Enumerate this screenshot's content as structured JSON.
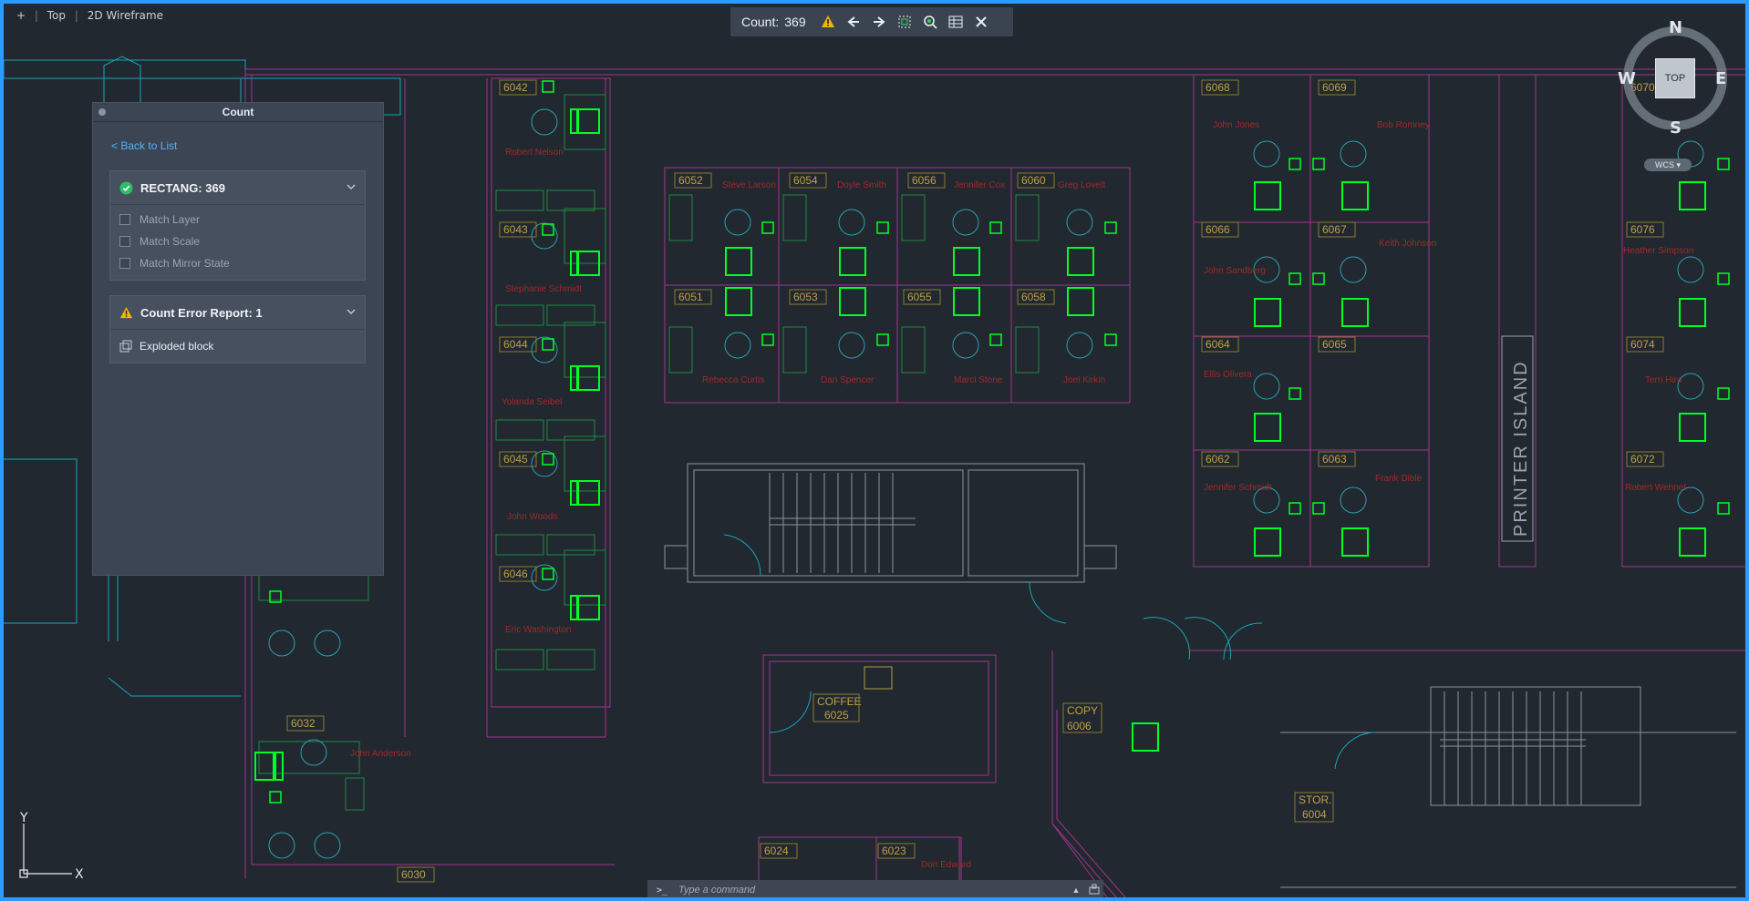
{
  "view": {
    "plus": "+",
    "viewport": "Top",
    "style": "2D Wireframe"
  },
  "count_toolbar": {
    "label": "Count:",
    "count": "369",
    "icons": [
      "warning-icon",
      "previous-icon",
      "next-icon",
      "zoom-extents-icon",
      "find-icon",
      "table-icon",
      "close-icon"
    ]
  },
  "palette": {
    "title": "Count",
    "back": "< Back to List",
    "count_section": {
      "title": "RECTANG: 369",
      "options": [
        "Match Layer",
        "Match Scale",
        "Match Mirror State"
      ]
    },
    "error_section": {
      "title": "Count Error Report: 1",
      "item": "Exploded block"
    }
  },
  "command": {
    "prompt": ">_",
    "placeholder": "Type a command"
  },
  "viewcube": {
    "north": "N",
    "south": "S",
    "east": "E",
    "west": "W",
    "top": "TOP",
    "wcs": "WCS"
  },
  "ucs": {
    "x": "X",
    "y": "Y"
  },
  "floorplan": {
    "room_numbers": [
      "6042",
      "6043",
      "6044",
      "6045",
      "6046",
      "6052",
      "6054",
      "6056",
      "6060",
      "6051",
      "6053",
      "6055",
      "6058",
      "6068",
      "6069",
      "6066",
      "6067",
      "6064",
      "6065",
      "6062",
      "6063",
      "6070",
      "6076",
      "6074",
      "6072",
      "6032",
      "6030",
      "6024",
      "6023"
    ],
    "names": [
      "Robert Nelson",
      "Stephanie Schmidt",
      "Yolanda Seibel",
      "John Woods",
      "Eric Washington",
      "Steve Larson",
      "Doyle Smith",
      "Jennifer Cox",
      "Greg Lovett",
      "Rebecca Curtis",
      "Dan Spencer",
      "Marci Stone",
      "Joel Kirkin",
      "John Jones",
      "Bob Romney",
      "John Sandberg",
      "Keith Johnson",
      "Ellis Olivera",
      "Jennifer Schmidt",
      "Frank Dible",
      "Heather Simpson",
      "Terri Hiro",
      "Robert Wehnet",
      "John Anderson",
      "Don Edward"
    ],
    "coffee": "COFFEE",
    "coffee_num": "6025",
    "copy": "COPY",
    "copy_num": "6006",
    "stor": "STOR.",
    "stor_num": "6004",
    "printer": "PRINTER ISLAND"
  },
  "colors": {
    "background": "#212830",
    "accent": "#2b9bff",
    "wall": "#b040c0",
    "highlight": "#00ff22",
    "label": "#c0a040",
    "name": "#a02828"
  }
}
